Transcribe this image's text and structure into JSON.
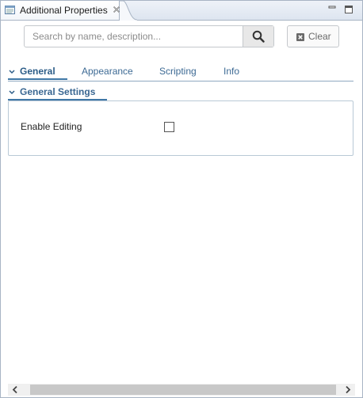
{
  "view": {
    "title": "Additional Properties"
  },
  "search": {
    "placeholder": "Search by name, description...",
    "value": ""
  },
  "clear_button": {
    "label": "Clear"
  },
  "tabs": [
    {
      "label": "General",
      "active": true
    },
    {
      "label": "Appearance",
      "active": false
    },
    {
      "label": "Scripting",
      "active": false
    },
    {
      "label": "Info",
      "active": false
    }
  ],
  "section": {
    "title": "General Settings",
    "expanded": true,
    "properties": [
      {
        "label": "Enable Editing",
        "checked": false
      }
    ]
  },
  "colors": {
    "accent": "#3f77a6",
    "tab_text": "#3d6a94"
  },
  "icons": [
    "view-icon",
    "close-icon",
    "minimize-icon",
    "maximize-icon",
    "search-icon",
    "clear-icon",
    "chevron-down-icon",
    "scroll-left-icon",
    "scroll-right-icon"
  ]
}
